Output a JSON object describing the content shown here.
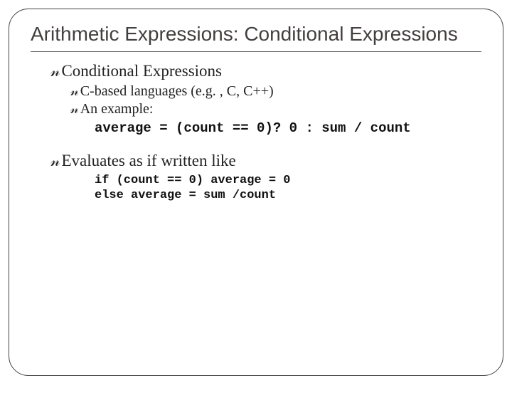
{
  "title": "Arithmetic Expressions: Conditional Expressions",
  "bullets": {
    "b1": "Conditional Expressions",
    "b1_1": "C-based languages (e.g. , C, C++)",
    "b1_2": "An example:",
    "code1": "average = (count == 0)? 0 : sum / count",
    "b2": "Evaluates as if written like",
    "code2a": "if (count == 0) average = 0",
    "code2b": "else average = sum /count"
  }
}
